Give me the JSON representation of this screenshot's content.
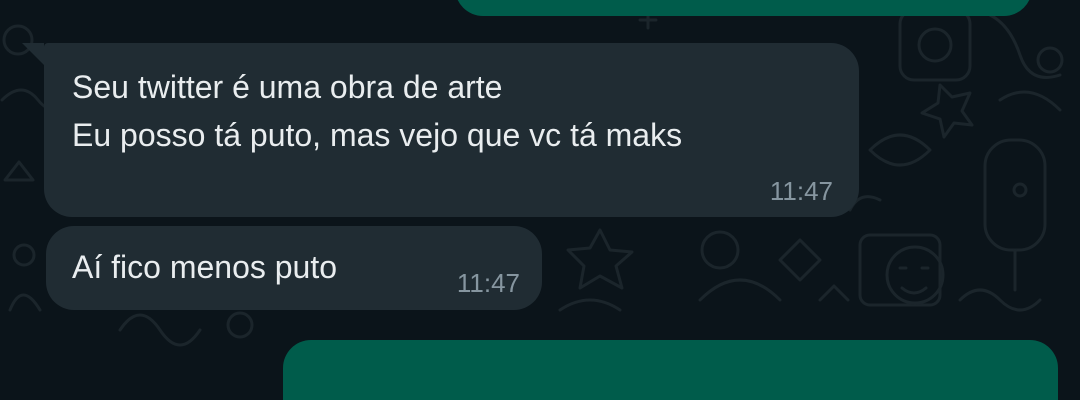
{
  "colors": {
    "background": "#0b141a",
    "incoming_bubble": "#202c33",
    "outgoing_bubble": "#005c4b",
    "message_text": "#e9edef",
    "timestamp_text": "#8696a0"
  },
  "messages": [
    {
      "direction": "incoming",
      "lines": [
        "Seu twitter é uma obra de arte",
        "Eu posso tá puto, mas vejo que vc tá maks"
      ],
      "time": "11:47"
    },
    {
      "direction": "incoming",
      "lines": [
        "Aí fico menos puto"
      ],
      "time": "11:47"
    }
  ]
}
